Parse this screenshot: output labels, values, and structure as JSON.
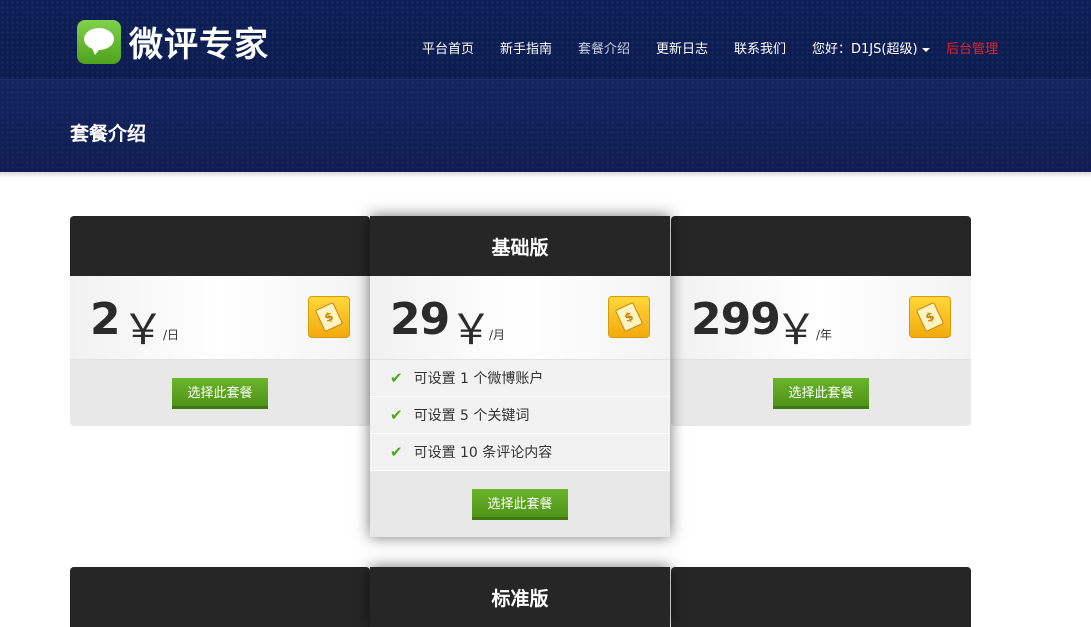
{
  "header": {
    "logo_text": "微评专家",
    "nav": [
      {
        "label": "平台首页"
      },
      {
        "label": "新手指南"
      },
      {
        "label": "套餐介绍"
      },
      {
        "label": "更新日志"
      },
      {
        "label": "联系我们"
      },
      {
        "label": "您好：D1JS(超级)"
      },
      {
        "label": "后台管理"
      }
    ],
    "admin_color": "#e0262b"
  },
  "page_title": "套餐介绍",
  "plans_row1": {
    "left": {
      "title": "",
      "price": "2",
      "currency": "￥",
      "unit": "/日",
      "button": "选择此套餐"
    },
    "middle": {
      "title": "基础版",
      "price": "29",
      "currency": "￥",
      "unit": "/月",
      "features": [
        "可设置 1 个微博账户",
        "可设置 5 个关键词",
        "可设置 10 条评论内容"
      ],
      "button": "选择此套餐"
    },
    "right": {
      "title": "",
      "price": "299",
      "currency": "￥",
      "unit": "/年",
      "button": "选择此套餐"
    }
  },
  "plans_row2": {
    "middle": {
      "title": "标准版"
    }
  },
  "colors": {
    "header_bg": "#0e1f57",
    "plan_header_bg": "#262626",
    "button_green": "#5aa322",
    "check_green": "#4caa1c",
    "tag_gold": "#f5b81a"
  }
}
